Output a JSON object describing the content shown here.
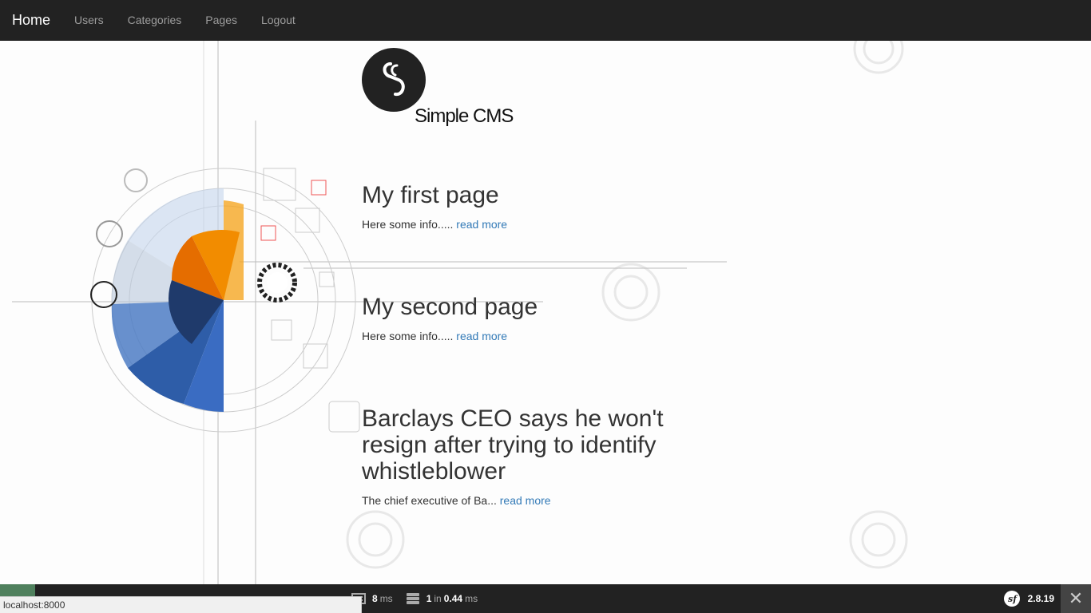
{
  "navbar": {
    "brand": "Home",
    "links": [
      "Users",
      "Categories",
      "Pages",
      "Logout"
    ]
  },
  "logo": {
    "text": "Simple CMS"
  },
  "posts": [
    {
      "title": "My first page",
      "excerpt": "Here some info.....",
      "link": "read more"
    },
    {
      "title": "My second page",
      "excerpt": "Here some info.....",
      "link": "read more"
    },
    {
      "title": "Barclays CEO says he won't resign after trying to identify whistleblower",
      "excerpt": "The chief executive of Ba...",
      "link": "read more"
    }
  ],
  "toolbar": {
    "time": "8",
    "time_unit": "ms",
    "db_count": "1",
    "db_in": "in",
    "db_time": "0.44",
    "db_unit": "ms",
    "version": "2.8.19",
    "close": "✕"
  },
  "status_bar": {
    "url": "localhost:8000"
  },
  "colors": {
    "navbar_bg": "#222222",
    "link": "#337ab7",
    "status_ok": "#4f805d"
  },
  "icons": [
    "symfony-logo-icon",
    "memory-icon",
    "database-icon",
    "close-icon"
  ]
}
